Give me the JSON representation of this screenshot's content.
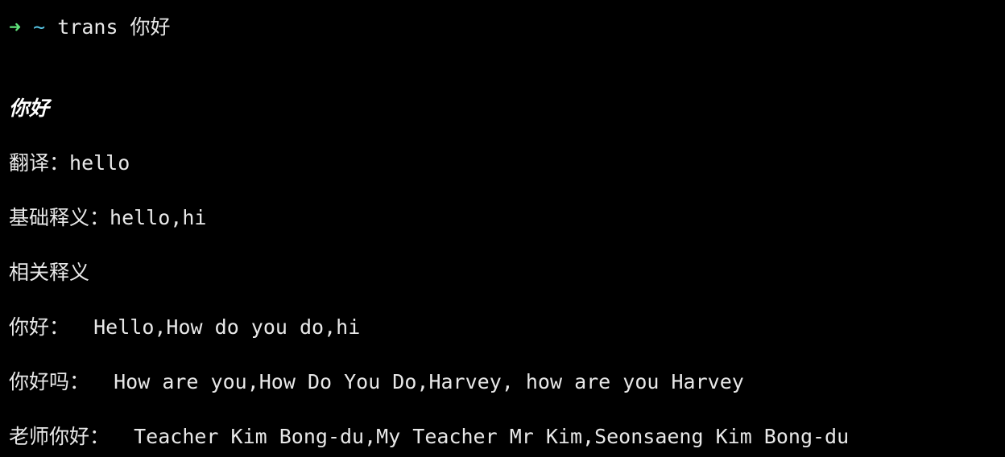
{
  "prompt": {
    "arrow": "➜",
    "cwd": "~",
    "command": "trans 你好"
  },
  "result": {
    "query": "你好",
    "translation_label": "翻译：",
    "translation_value": "hello",
    "basic_label": "基础释义：",
    "basic_value": "hello,hi",
    "related_heading": "相关释义",
    "related": [
      {
        "term": "你好：",
        "meaning": "Hello,How do you do,hi"
      },
      {
        "term": "你好吗：",
        "meaning": "How are you,How Do You Do,Harvey, how are you Harvey"
      },
      {
        "term": "老师你好：",
        "meaning": "Teacher Kim Bong-du,My Teacher Mr Kim,Seonsaeng Kim Bong-du"
      }
    ]
  },
  "colors": {
    "background": "#000000",
    "text": "#e8e8e8",
    "prompt_arrow": "#5fe37a",
    "prompt_cwd": "#58c8e8"
  }
}
